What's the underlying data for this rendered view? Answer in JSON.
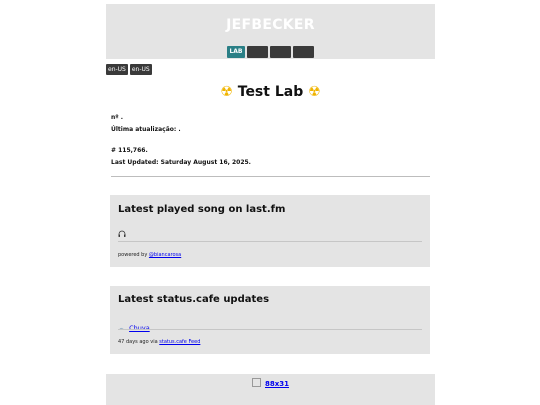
{
  "header": {
    "site_title": "JEFBECKER",
    "nav": [
      {
        "label": "LAB",
        "active": true
      },
      {
        "label": "",
        "active": false
      },
      {
        "label": "",
        "active": false
      },
      {
        "label": "",
        "active": false
      }
    ]
  },
  "languages": [
    "en-US",
    "en-US"
  ],
  "page": {
    "title": "Test Lab",
    "title_icon": "radioactive-icon",
    "meta_pt": {
      "number": "nº .",
      "updated": "Última atualização: ."
    },
    "meta_en": {
      "number": "# 115,766.",
      "updated": "Last Updated: Saturday August 16, 2025."
    }
  },
  "lastfm": {
    "heading": "Latest played song on last.fm",
    "icon": "headphones-icon",
    "powered_prefix": "powered by",
    "powered_link": "@biancarosa"
  },
  "statuscafe": {
    "heading": "Latest status.cafe updates",
    "status_icon": "cloud-icon",
    "status_text": "Chuva",
    "footer_prefix": "47 days ago via",
    "footer_link": "status.cafe Feed"
  },
  "footer": {
    "badge_alt": "88x31"
  }
}
